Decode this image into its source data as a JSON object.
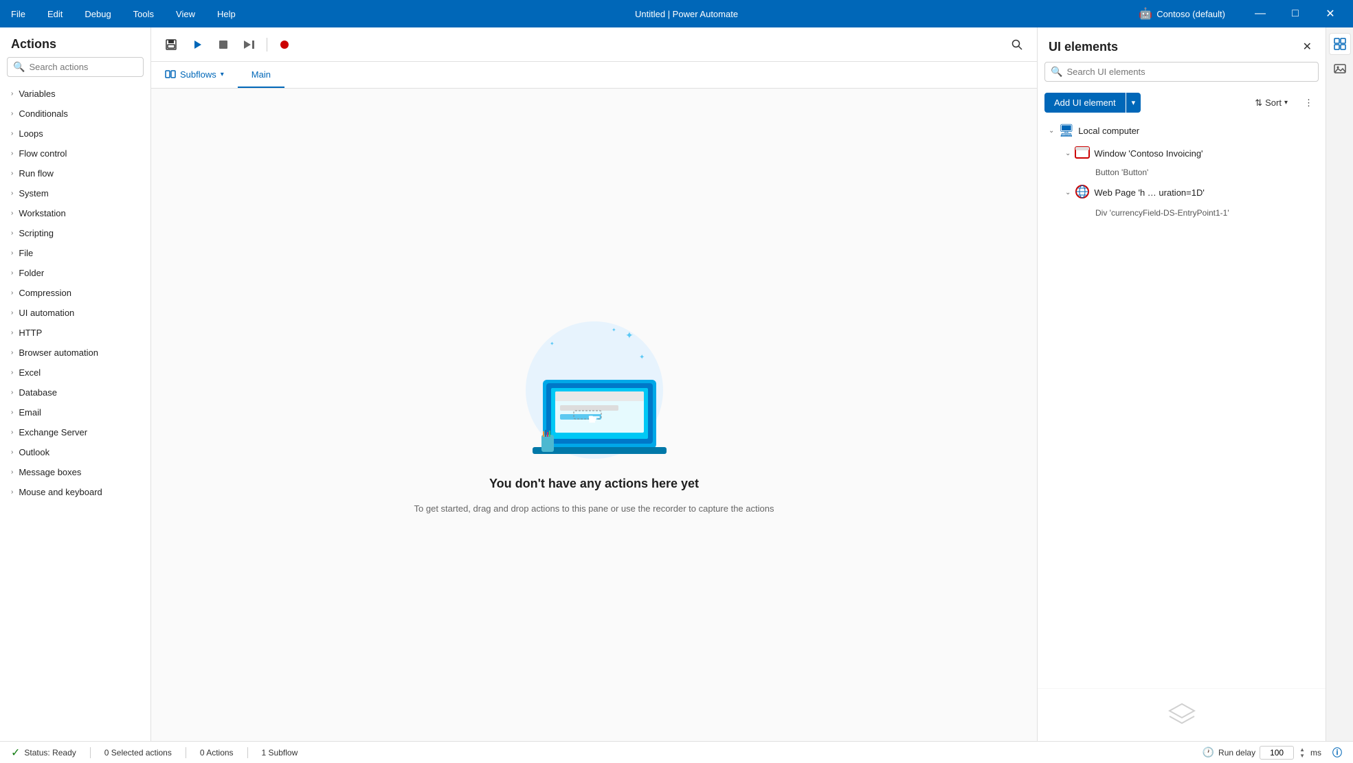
{
  "titlebar": {
    "menu": [
      "File",
      "Edit",
      "Debug",
      "Tools",
      "View",
      "Help"
    ],
    "title": "Untitled | Power Automate",
    "user": "Contoso (default)",
    "min": "—",
    "max": "□",
    "close": "✕"
  },
  "actions_panel": {
    "header": "Actions",
    "search_placeholder": "Search actions",
    "items": [
      "Variables",
      "Conditionals",
      "Loops",
      "Flow control",
      "Run flow",
      "System",
      "Workstation",
      "Scripting",
      "File",
      "Folder",
      "Compression",
      "UI automation",
      "HTTP",
      "Browser automation",
      "Excel",
      "Database",
      "Email",
      "Exchange Server",
      "Outlook",
      "Message boxes",
      "Mouse and keyboard"
    ]
  },
  "toolbar": {
    "save_label": "💾",
    "run_label": "▶",
    "stop_label": "■",
    "next_label": "⏭"
  },
  "tabs": {
    "subflows_label": "Subflows",
    "main_label": "Main"
  },
  "canvas": {
    "empty_title": "You don't have any actions here yet",
    "empty_subtitle": "To get started, drag and drop actions to this pane\nor use the recorder to capture the actions"
  },
  "ui_elements_panel": {
    "header": "UI elements",
    "search_placeholder": "Search UI elements",
    "add_button": "Add UI element",
    "sort_label": "Sort",
    "tree": {
      "local_computer": "Local computer",
      "window_label": "Window 'Contoso Invoicing'",
      "button_label": "Button 'Button'",
      "webpage_label": "Web Page 'h … uration=1D'",
      "div_label": "Div 'currencyField-DS-EntryPoint1-1'"
    }
  },
  "statusbar": {
    "status_label": "Status: Ready",
    "selected_actions": "0 Selected actions",
    "actions_count": "0 Actions",
    "subflow_count": "1 Subflow",
    "run_delay_label": "Run delay",
    "run_delay_value": "100",
    "ms_label": "ms"
  }
}
